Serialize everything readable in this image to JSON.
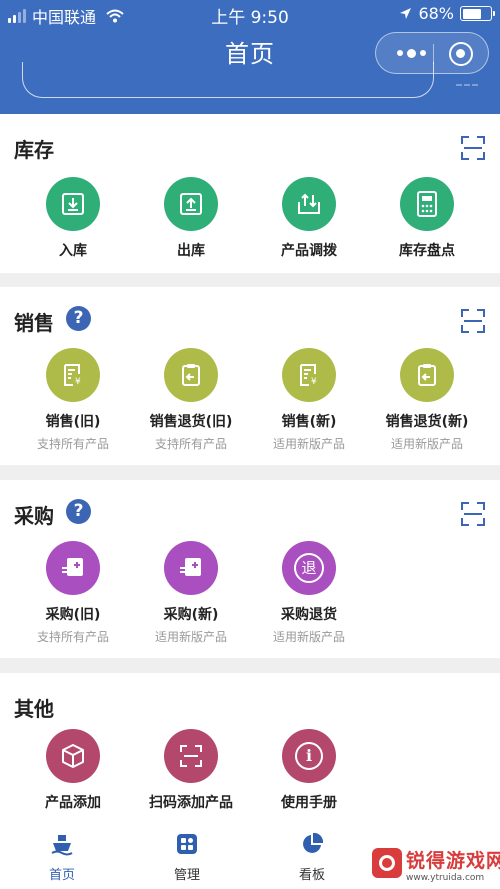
{
  "status_bar": {
    "carrier": "中国联通",
    "time": "上午 9:50",
    "battery": "68%",
    "battery_level": 0.68
  },
  "nav": {
    "title": "首页"
  },
  "colors": {
    "primary": "#3d6dbf",
    "teal": "#2fae78",
    "olive": "#afbb48",
    "purple": "#a94fbf",
    "rose": "#b4486c",
    "help": "#3c66b4"
  },
  "sections": {
    "inventory": {
      "title": "库存",
      "items": [
        {
          "label": "入库",
          "icon": "inbound-box-icon"
        },
        {
          "label": "出库",
          "icon": "outbound-box-icon"
        },
        {
          "label": "产品调拨",
          "icon": "transfer-icon"
        },
        {
          "label": "库存盘点",
          "icon": "calculator-icon"
        }
      ]
    },
    "sales": {
      "title": "销售",
      "items": [
        {
          "label": "销售(旧)",
          "sub": "支持所有产品",
          "icon": "sales-doc-icon"
        },
        {
          "label": "销售退货(旧)",
          "sub": "支持所有产品",
          "icon": "sales-return-icon"
        },
        {
          "label": "销售(新)",
          "sub": "适用新版产品",
          "icon": "sales-doc-icon"
        },
        {
          "label": "销售退货(新)",
          "sub": "适用新版产品",
          "icon": "sales-return-icon"
        }
      ]
    },
    "purchase": {
      "title": "采购",
      "items": [
        {
          "label": "采购(旧)",
          "sub": "支持所有产品",
          "icon": "purchase-icon"
        },
        {
          "label": "采购(新)",
          "sub": "适用新版产品",
          "icon": "purchase-icon"
        },
        {
          "label": "采购退货",
          "sub": "适用新版产品",
          "icon": "return-stamp-icon",
          "glyph": "退"
        }
      ]
    },
    "other": {
      "title": "其他",
      "items": [
        {
          "label": "产品添加",
          "icon": "product-box-icon"
        },
        {
          "label": "扫码添加产品",
          "icon": "scan-icon"
        },
        {
          "label": "使用手册",
          "icon": "info-icon",
          "glyph": "i"
        }
      ]
    }
  },
  "tabbar": {
    "tabs": [
      {
        "label": "首页"
      },
      {
        "label": "管理"
      },
      {
        "label": "看板"
      }
    ]
  },
  "watermark": {
    "name": "锐得游戏网",
    "url": "www.ytruida.com"
  }
}
